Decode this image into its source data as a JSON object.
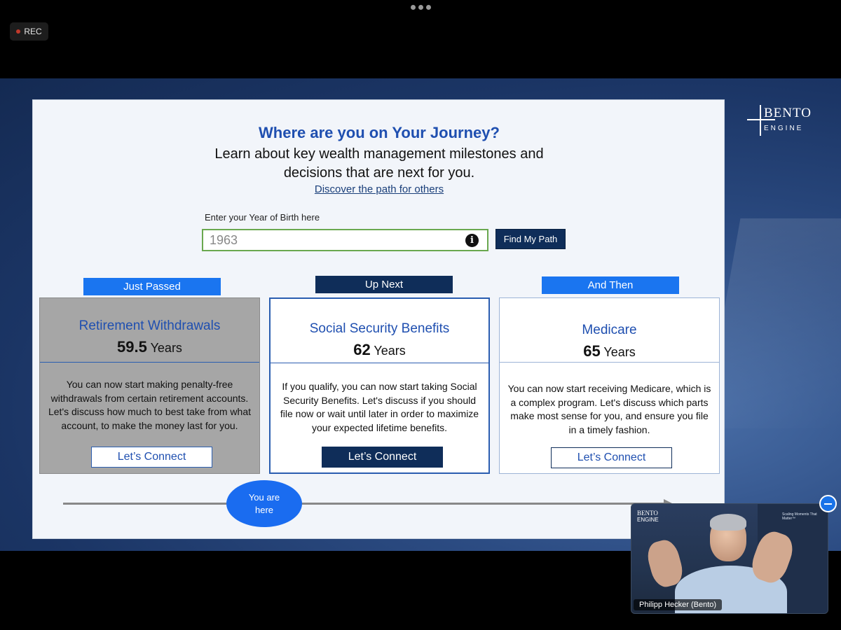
{
  "top_bar": {
    "rec_label": "REC"
  },
  "brand": {
    "logo_line1": "BENTO",
    "logo_line2": "ENGINE"
  },
  "slide": {
    "title": "Where are you on Your Journey?",
    "subtitle_line1": "Learn about key wealth management milestones and",
    "subtitle_line2": "decisions that are next for you.",
    "discover_link": "Discover the path for others",
    "yob_label": "Enter your Year of Birth here",
    "yob_value": "1963",
    "find_button": "Find My Path",
    "info_icon": "i",
    "cards": [
      {
        "tag": "Just Passed",
        "title": "Retirement Withdrawals",
        "age": "59.5",
        "unit": "Years",
        "body": "You can now start making penalty-free withdrawals from certain retirement accounts. Let's discuss how much to best take from what account, to make the money last for you.",
        "button": "Let’s Connect"
      },
      {
        "tag": "Up Next",
        "title": "Social Security Benefits",
        "age": "62",
        "unit": "Years",
        "body": "If you qualify, you can now start taking Social Security Benefits. Let's discuss if you should file now or wait until later in order to maximize your expected lifetime benefits.",
        "button": "Let’s Connect"
      },
      {
        "tag": "And Then",
        "title": "Medicare",
        "age": "65",
        "unit": "Years",
        "body": "You can now start receiving Medicare, which is a complex program. Let's discuss which parts make most sense for you, and ensure you file in a timely fashion.",
        "button": "Let’s Connect"
      }
    ],
    "you_are_here_line1": "You are",
    "you_are_here_line2": "here"
  },
  "video_tile": {
    "participant_name": "Philipp Hecker (Bento)",
    "logo_line1": "BENTO",
    "logo_line2": "ENGINE",
    "tagline": "Scaling Moments That Matter™"
  },
  "colors": {
    "accent_blue": "#1a75f0",
    "navy": "#0f2d59",
    "title_blue": "#1f4fb0"
  }
}
